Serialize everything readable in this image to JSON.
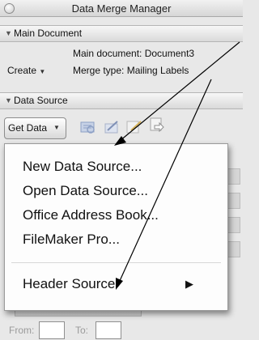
{
  "window": {
    "title": "Data Merge Manager"
  },
  "main_document": {
    "header": "Main Document",
    "create_label": "Create",
    "main_doc_text": "Main document: Document3",
    "merge_type_text": "Merge type: Mailing Labels"
  },
  "data_source": {
    "header": "Data Source",
    "get_data_label": "Get Data"
  },
  "menu": {
    "items": [
      {
        "label": "New Data Source..."
      },
      {
        "label": "Open Data Source..."
      },
      {
        "label": "Office Address Book..."
      },
      {
        "label": "FileMaker Pro..."
      },
      {
        "label": "Header Source"
      }
    ],
    "submenu_arrow": "▶"
  },
  "range": {
    "from_label": "From:",
    "to_label": "To:",
    "from_value": "",
    "to_value": ""
  },
  "colors": {
    "annotation_arrow": "#000000",
    "menu_shadow": "rgba(0,0,0,0.45)"
  }
}
